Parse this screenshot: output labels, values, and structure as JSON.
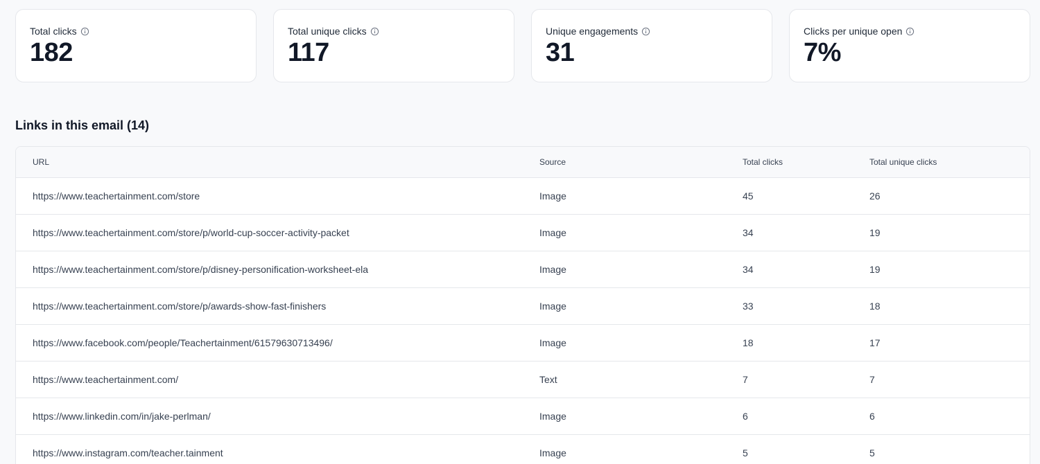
{
  "stats": [
    {
      "label": "Total clicks",
      "value": "182"
    },
    {
      "label": "Total unique clicks",
      "value": "117"
    },
    {
      "label": "Unique engagements",
      "value": "31"
    },
    {
      "label": "Clicks per unique open",
      "value": "7%"
    }
  ],
  "links_section": {
    "title": "Links in this email (14)",
    "columns": {
      "url": "URL",
      "source": "Source",
      "total_clicks": "Total clicks",
      "total_unique_clicks": "Total unique clicks"
    },
    "rows": [
      {
        "url": "https://www.teachertainment.com/store",
        "source": "Image",
        "total_clicks": "45",
        "total_unique_clicks": "26"
      },
      {
        "url": "https://www.teachertainment.com/store/p/world-cup-soccer-activity-packet",
        "source": "Image",
        "total_clicks": "34",
        "total_unique_clicks": "19"
      },
      {
        "url": "https://www.teachertainment.com/store/p/disney-personification-worksheet-ela",
        "source": "Image",
        "total_clicks": "34",
        "total_unique_clicks": "19"
      },
      {
        "url": "https://www.teachertainment.com/store/p/awards-show-fast-finishers",
        "source": "Image",
        "total_clicks": "33",
        "total_unique_clicks": "18"
      },
      {
        "url": "https://www.facebook.com/people/Teachertainment/61579630713496/",
        "source": "Image",
        "total_clicks": "18",
        "total_unique_clicks": "17"
      },
      {
        "url": "https://www.teachertainment.com/",
        "source": "Text",
        "total_clicks": "7",
        "total_unique_clicks": "7"
      },
      {
        "url": "https://www.linkedin.com/in/jake-perlman/",
        "source": "Image",
        "total_clicks": "6",
        "total_unique_clicks": "6"
      },
      {
        "url": "https://www.instagram.com/teacher.tainment",
        "source": "Image",
        "total_clicks": "5",
        "total_unique_clicks": "5"
      }
    ]
  }
}
